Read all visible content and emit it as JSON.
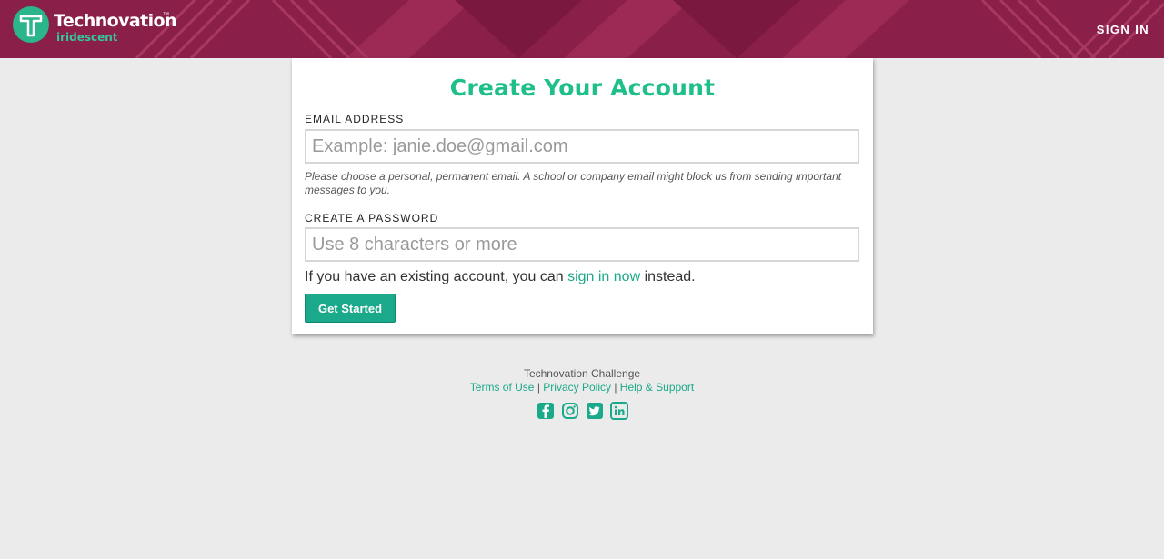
{
  "header": {
    "brand_name": "Technovation",
    "brand_tm": "™",
    "brand_sub": "iridescent",
    "signin_label": "SIGN IN",
    "bg_color": "#8a1f4a",
    "accent_color": "#2bb58a"
  },
  "form": {
    "title": "Create Your Account",
    "email": {
      "label": "EMAIL ADDRESS",
      "placeholder": "Example: janie.doe@gmail.com",
      "value": "",
      "hint": "Please choose a personal, permanent email. A school or company email might block us from sending important messages to you."
    },
    "password": {
      "label": "CREATE A PASSWORD",
      "placeholder": "Use 8 characters or more",
      "value": ""
    },
    "existing": {
      "prefix": "If you have an existing account, you can ",
      "link": "sign in now",
      "suffix": " instead."
    },
    "submit_label": "Get Started"
  },
  "footer": {
    "org": "Technovation Challenge",
    "links": {
      "terms": "Terms of Use",
      "privacy": "Privacy Policy",
      "help": "Help & Support"
    },
    "separator": "|",
    "social": [
      "facebook-icon",
      "instagram-icon",
      "twitter-icon",
      "linkedin-icon"
    ]
  }
}
